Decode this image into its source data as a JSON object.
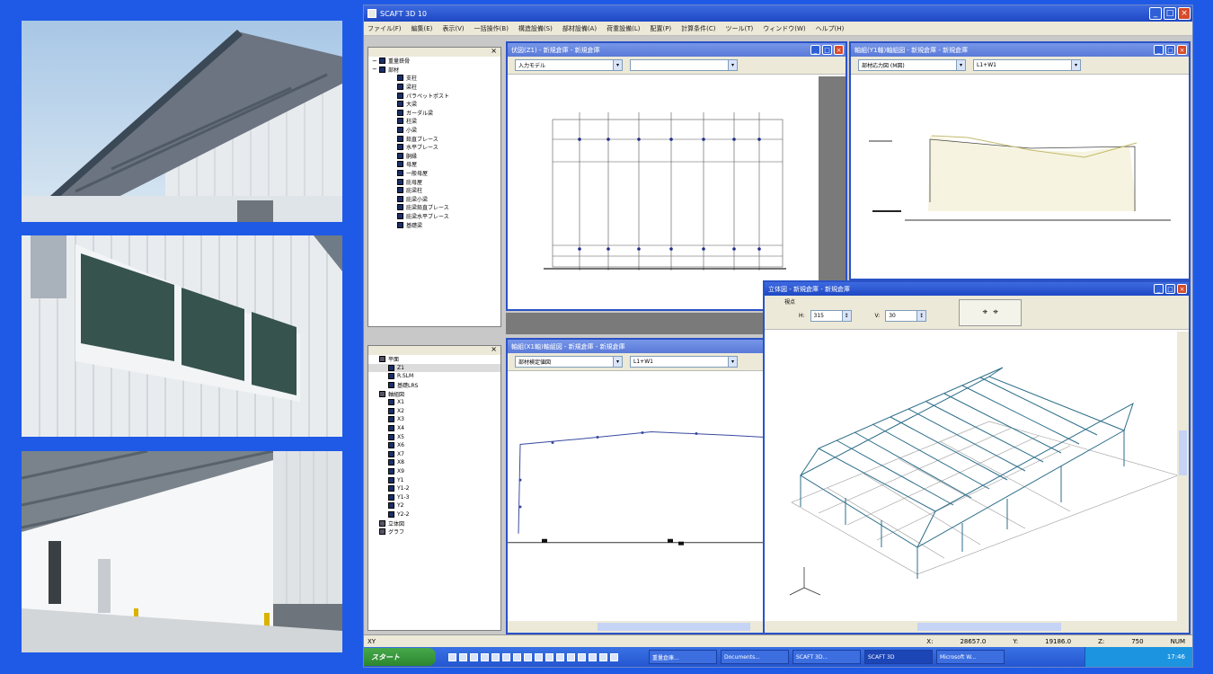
{
  "window": {
    "title": "SCAFT 3D 10",
    "menu": [
      "ファイル(F)",
      "編集(E)",
      "表示(V)",
      "一括操作(B)",
      "構造設備(S)",
      "部材設備(A)",
      "荷重設備(L)",
      "配置(P)",
      "計算条件(C)",
      "ツール(T)",
      "ウィンドウ(W)",
      "ヘルプ(H)"
    ]
  },
  "tree_top": {
    "items": [
      {
        "label": "重量鉄骨",
        "level": 0,
        "expander": "−"
      },
      {
        "label": "部材",
        "level": 0,
        "expander": "−"
      },
      {
        "label": "支柱",
        "level": 2
      },
      {
        "label": "梁柱",
        "level": 2
      },
      {
        "label": "パラペットポスト",
        "level": 2
      },
      {
        "label": "大梁",
        "level": 2
      },
      {
        "label": "ガーダル梁",
        "level": 2
      },
      {
        "label": "柱梁",
        "level": 2
      },
      {
        "label": "小梁",
        "level": 2
      },
      {
        "label": "鉛直ブレース",
        "level": 2
      },
      {
        "label": "水平ブレース",
        "level": 2
      },
      {
        "label": "胴縁",
        "level": 2
      },
      {
        "label": "母屋",
        "level": 2
      },
      {
        "label": "一般母屋",
        "level": 2
      },
      {
        "label": "庇母屋",
        "level": 2
      },
      {
        "label": "庇梁柱",
        "level": 2
      },
      {
        "label": "庇梁小梁",
        "level": 2
      },
      {
        "label": "庇梁鉛直ブレース",
        "level": 2
      },
      {
        "label": "庇梁水平ブレース",
        "level": 2
      },
      {
        "label": "基礎梁",
        "level": 2
      }
    ]
  },
  "tree_bottom": {
    "items": [
      {
        "label": "平面",
        "level": 0,
        "type": "g"
      },
      {
        "label": "Z1",
        "level": 1,
        "sel": true
      },
      {
        "label": "R.SLM",
        "level": 1
      },
      {
        "label": "基礎LRS",
        "level": 1
      },
      {
        "label": "軸組図",
        "level": 0,
        "type": "g"
      },
      {
        "label": "X1",
        "level": 1
      },
      {
        "label": "X2",
        "level": 1
      },
      {
        "label": "X3",
        "level": 1
      },
      {
        "label": "X4",
        "level": 1
      },
      {
        "label": "X5",
        "level": 1
      },
      {
        "label": "X6",
        "level": 1
      },
      {
        "label": "X7",
        "level": 1
      },
      {
        "label": "X8",
        "level": 1
      },
      {
        "label": "X9",
        "level": 1
      },
      {
        "label": "Y1",
        "level": 1
      },
      {
        "label": "Y1-2",
        "level": 1
      },
      {
        "label": "Y1-3",
        "level": 1
      },
      {
        "label": "Y2",
        "level": 1
      },
      {
        "label": "Y2-2",
        "level": 1
      },
      {
        "label": "立体図",
        "level": 0,
        "type": "g"
      },
      {
        "label": "グラフ",
        "level": 0,
        "type": "g"
      }
    ]
  },
  "windows": {
    "plan": {
      "title": "伏図(Z1) - 新規倉庫 - 新規倉庫",
      "combo1": "入力モデル",
      "combo2": ""
    },
    "frame1": {
      "title": "軸組(Y1軸)軸組図 - 新規倉庫 - 新規倉庫",
      "combo1": "部材応力図 (M図)",
      "combo2": "L1+W1"
    },
    "frame2": {
      "title": "軸組(X1軸)軸組図 - 新規倉庫 - 新規倉庫",
      "combo1": "部材検定値図",
      "combo2": "L1+W1"
    },
    "iso": {
      "title": "立体図 - 新規倉庫 - 新規倉庫",
      "group_label": "視点",
      "h_label": "H:",
      "h_value": "315",
      "v_label": "V:",
      "v_value": "30"
    }
  },
  "statusbar": {
    "left": "XY",
    "right": [
      "X:",
      "28657.0",
      "Y:",
      "19186.0",
      "Z:",
      "750",
      "NUM"
    ]
  },
  "taskbar": {
    "start": "スタート",
    "tasks": [
      "重量倉庫...",
      "Documents...",
      "SCAFT 3D...",
      "SCAFT 3D",
      "Microsoft W..."
    ],
    "active_index": 3,
    "clock": "17:46"
  }
}
